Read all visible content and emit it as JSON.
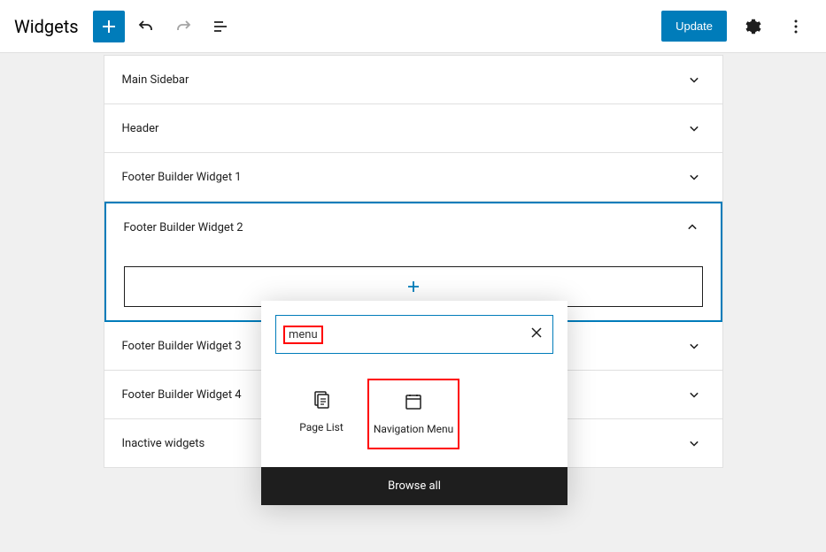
{
  "header": {
    "title": "Widgets",
    "update_label": "Update"
  },
  "widget_areas": [
    {
      "label": "Main Sidebar",
      "expanded": false
    },
    {
      "label": "Header",
      "expanded": false
    },
    {
      "label": "Footer Builder Widget 1",
      "expanded": false
    },
    {
      "label": "Footer Builder Widget 2",
      "expanded": true
    },
    {
      "label": "Footer Builder Widget 3",
      "expanded": false
    },
    {
      "label": "Footer Builder Widget 4",
      "expanded": false
    },
    {
      "label": "Inactive widgets",
      "expanded": false
    }
  ],
  "inserter": {
    "search_value": "menu",
    "blocks": [
      {
        "name": "page-list",
        "label": "Page List"
      },
      {
        "name": "navigation-menu",
        "label": "Navigation Menu"
      }
    ],
    "browse_all_label": "Browse all"
  }
}
